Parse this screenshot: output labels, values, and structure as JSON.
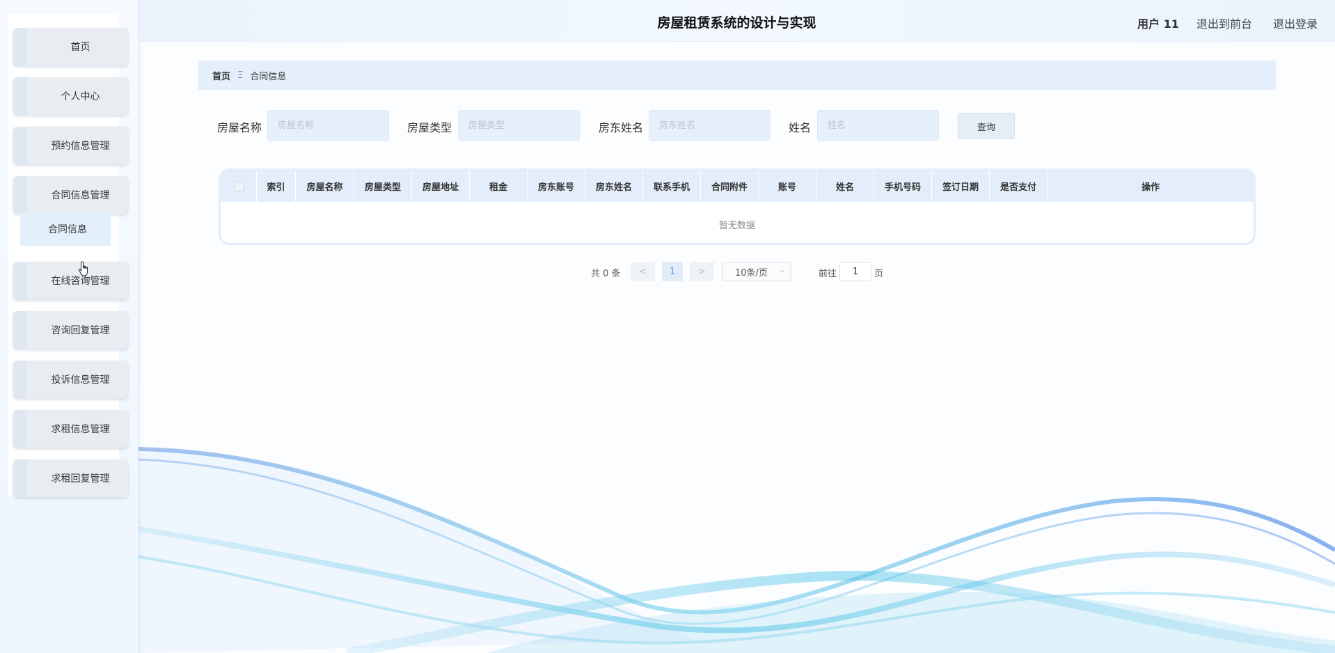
{
  "header": {
    "title": "房屋租赁系统的设计与实现",
    "user": "用户 11",
    "back_to_front": "退出到前台",
    "logout": "退出登录"
  },
  "sidebar": {
    "items": [
      {
        "label": "首页"
      },
      {
        "label": "个人中心"
      },
      {
        "label": "预约信息管理"
      },
      {
        "label": "合同信息管理"
      },
      {
        "label": "在线咨询管理"
      },
      {
        "label": "咨询回复管理"
      },
      {
        "label": "投诉信息管理"
      },
      {
        "label": "求租信息管理"
      },
      {
        "label": "求租回复管理"
      }
    ],
    "submenu": {
      "label": "合同信息"
    }
  },
  "breadcrumb": {
    "home": "首页",
    "separator": "Ξ",
    "current": "合同信息"
  },
  "search": {
    "house_name_label": "房屋名称",
    "house_name_placeholder": "房屋名称",
    "house_type_label": "房屋类型",
    "house_type_placeholder": "房屋类型",
    "landlord_name_label": "房东姓名",
    "landlord_name_placeholder": "房东姓名",
    "name_label": "姓名",
    "name_placeholder": "姓名",
    "query_button": "查询"
  },
  "table": {
    "columns": [
      "索引",
      "房屋名称",
      "房屋类型",
      "房屋地址",
      "租金",
      "房东账号",
      "房东姓名",
      "联系手机",
      "合同附件",
      "账号",
      "姓名",
      "手机号码",
      "签订日期",
      "是否支付",
      "操作"
    ],
    "empty_text": "暂无数据"
  },
  "pagination": {
    "total": "共 0 条",
    "prev": "<",
    "current_page": "1",
    "next": ">",
    "page_size": "10条/页",
    "goto_label": "前往",
    "goto_value": "1",
    "page_unit": "页"
  },
  "colors": {
    "accent": "#409eff",
    "header_bg": "#eaf3fc",
    "breadcrumb_bg": "#e4effb",
    "input_bg": "#e6f0fb"
  },
  "icons": {
    "cursor": "hand-pointer-icon",
    "select_chevron": "chevron-down-icon"
  }
}
